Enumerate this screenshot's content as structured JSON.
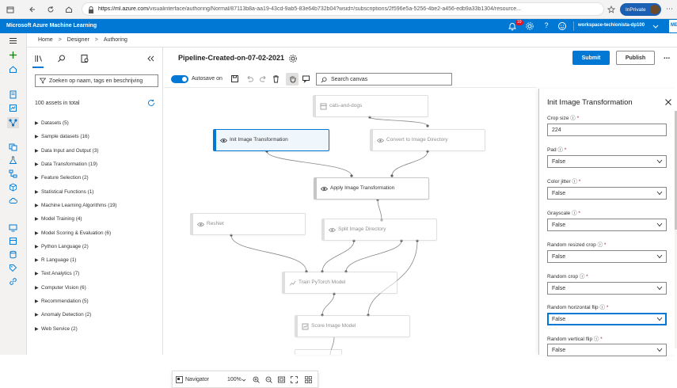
{
  "browser": {
    "url_host": "https://ml.azure.com",
    "url_path": "/visualinterface/authoring/Normal/87113b8a-aa19-43cd-9ab5-83e64b732b04?wsid=/subscriptions/2f596e5a-5256-4be2-a456-edb9a33b1304/resource...",
    "inprivate_label": "InPrivate"
  },
  "header": {
    "app_title": "Microsoft Azure Machine Learning",
    "notification_count": "10",
    "workspace": "workspace-techionista-dp100",
    "user_initials": "ME"
  },
  "breadcrumb": [
    "Home",
    "Designer",
    "Authoring"
  ],
  "assets": {
    "search_placeholder": "Zoeken op naam, tags en beschrijving",
    "count_text": "100 assets in total",
    "categories": [
      "Datasets (5)",
      "Sample datasets (16)",
      "Data Input and Output (3)",
      "Data Transformation (19)",
      "Feature Selection (2)",
      "Statistical Functions (1)",
      "Machine Learning Algorithms (19)",
      "Model Training (4)",
      "Model Scoring & Evaluation (6)",
      "Python Language (2)",
      "R Language (1)",
      "Text Analytics (7)",
      "Computer Vision (6)",
      "Recommendation (5)",
      "Anomaly Detection (2)",
      "Web Service (2)"
    ]
  },
  "canvas": {
    "pipeline_title": "Pipeline-Created-on-07-02-2021",
    "autosave_label": "Autosave on",
    "search_placeholder": "Search canvas",
    "nodes": {
      "cats_and_dogs": "cats-and-dogs",
      "init_image": "Init Image Transformation",
      "convert_dir": "Convert to Image Directory",
      "apply_image": "Apply Image Transformation",
      "resnet": "ResNet",
      "split_dir": "Split Image Directory",
      "train_pytorch": "Train PyTorch Model",
      "score_image": "Score Image Model"
    },
    "navigator_label": "Navigator",
    "zoom": "100%"
  },
  "actions": {
    "submit": "Submit",
    "publish": "Publish",
    "more": "..."
  },
  "properties": {
    "title": "Init Image Transformation",
    "fields": [
      {
        "label": "Crop size",
        "value": "224",
        "type": "text"
      },
      {
        "label": "Pad",
        "value": "False",
        "type": "select"
      },
      {
        "label": "Color jitter",
        "value": "False",
        "type": "select"
      },
      {
        "label": "Grayscale",
        "value": "False",
        "type": "select"
      },
      {
        "label": "Random resized crop",
        "value": "False",
        "type": "select"
      },
      {
        "label": "Random crop",
        "value": "False",
        "type": "select"
      },
      {
        "label": "Random horizontal flip",
        "value": "False",
        "type": "select"
      },
      {
        "label": "Random vertical flip",
        "value": "False",
        "type": "select"
      }
    ],
    "required_mark": "*"
  },
  "colors": {
    "accent": "#0078d4",
    "header_bg": "#0078d4",
    "required": "#a4262c"
  }
}
